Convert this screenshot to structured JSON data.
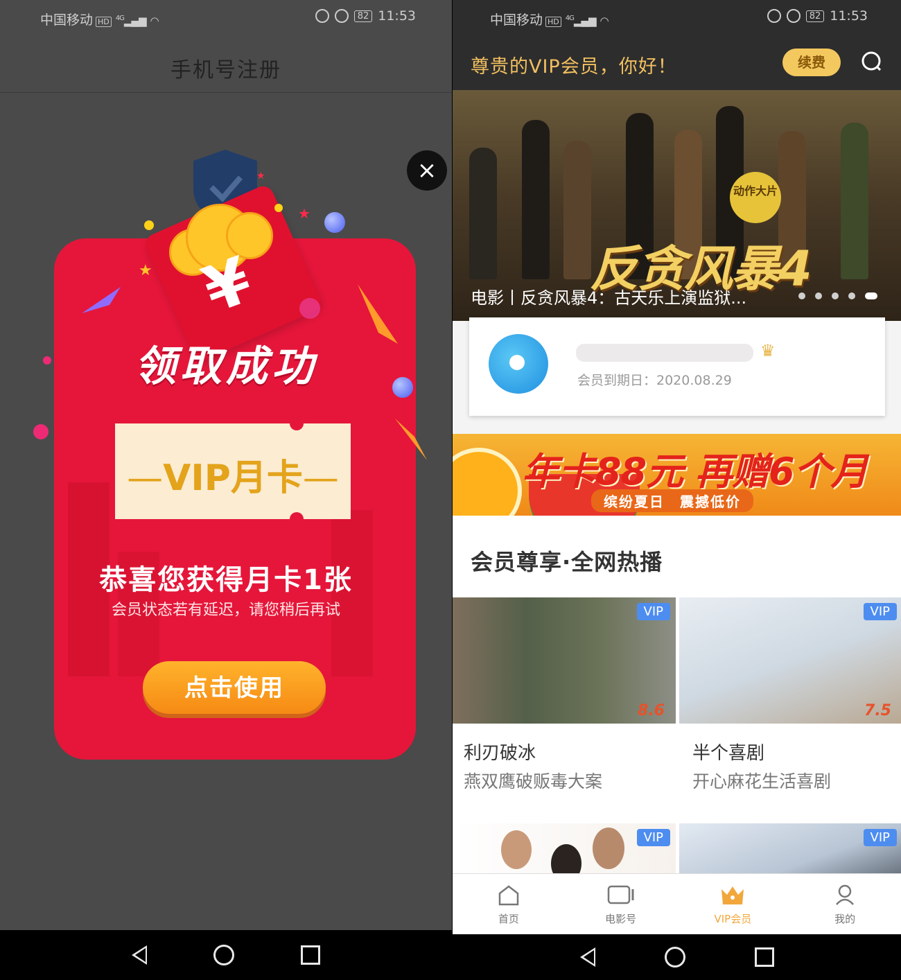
{
  "left": {
    "status": {
      "carrier": "中国移动",
      "hd": "HD",
      "signal": "4G",
      "battery": "82",
      "time": "11:53"
    },
    "title": "手机号注册",
    "close_icon": "×",
    "popup": {
      "heading": "领取成功",
      "ticket": "VIP月卡",
      "congrats": "恭喜您获得月卡1张",
      "note": "会员状态若有延迟，请您稍后再试",
      "button": "点击使用"
    }
  },
  "right": {
    "status": {
      "carrier": "中国移动",
      "hd": "HD",
      "signal": "4G",
      "battery": "82",
      "time": "11:53"
    },
    "greeting": "尊贵的VIP会员，你好！",
    "renew": "续费",
    "banner": {
      "poster_title": "反贪风暴4",
      "badge": "动作大片",
      "caption": "电影丨反贪风暴4：古天乐上演监狱...",
      "pager_count": 5,
      "active_page": 5
    },
    "member": {
      "expire": "会员到期日：2020.08.29"
    },
    "promo": {
      "headline": "年卡88元 再赠6个月",
      "tagline": "缤纷夏日　震撼低价"
    },
    "section_title": "会员尊享·全网热播",
    "movies": [
      {
        "title": "利刃破冰",
        "subtitle": "燕双鹰破贩毒大案",
        "badge": "VIP",
        "score": "8.6"
      },
      {
        "title": "半个喜剧",
        "subtitle": "开心麻花生活喜剧",
        "badge": "VIP",
        "score": "7.5"
      }
    ],
    "more_badges": [
      "VIP",
      "VIP"
    ],
    "tabs": [
      {
        "label": "首页",
        "icon": "home-icon",
        "active": false
      },
      {
        "label": "电影号",
        "icon": "video-icon",
        "active": false
      },
      {
        "label": "VIP会员",
        "icon": "crown-icon",
        "active": true
      },
      {
        "label": "我的",
        "icon": "profile-icon",
        "active": false
      }
    ]
  },
  "colors": {
    "popup_red": "#e5163a",
    "gold": "#f2c060",
    "vip_blue": "#4d8df0",
    "button_orange": "#f68a14"
  }
}
